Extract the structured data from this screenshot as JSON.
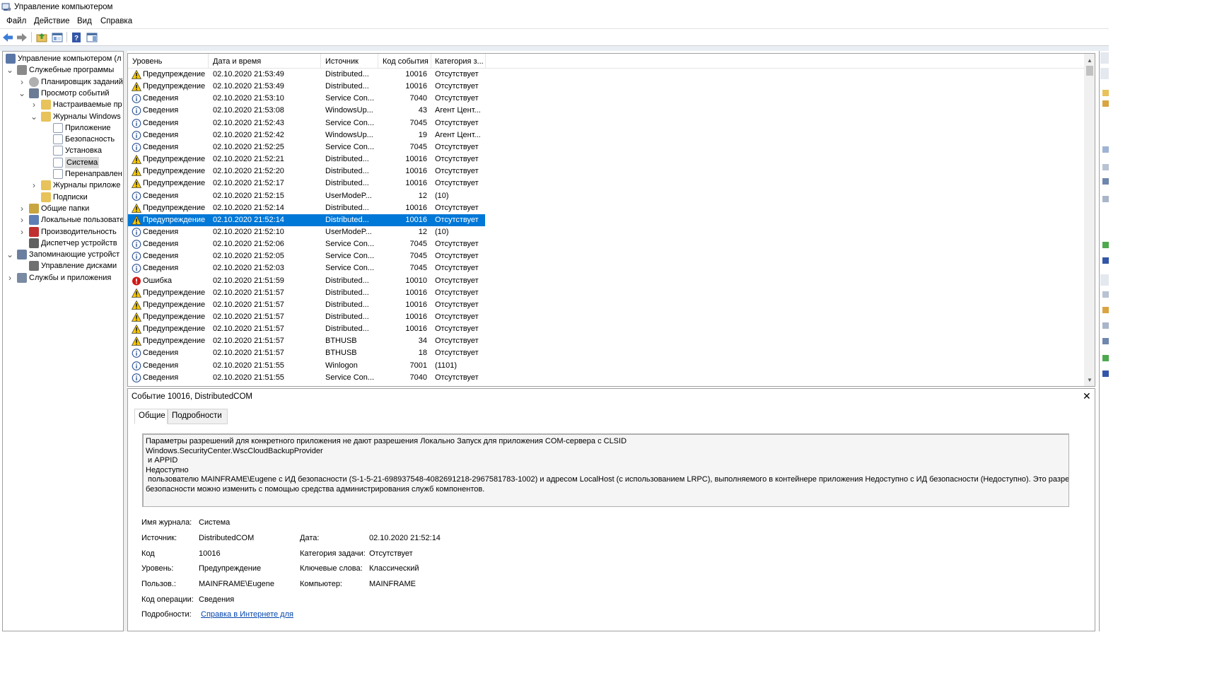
{
  "window": {
    "title": "Управление компьютером"
  },
  "menu": [
    "Файл",
    "Действие",
    "Вид",
    "Справка"
  ],
  "tree": [
    {
      "label": "Управление компьютером (л",
      "icon": "computer-management-icon",
      "expander": ""
    },
    {
      "label": "Служебные программы",
      "icon": "tools-icon",
      "expander": "expanded"
    },
    {
      "label": "Планировщик заданий",
      "icon": "clock-icon",
      "expander": "collapsed"
    },
    {
      "label": "Просмотр событий",
      "icon": "event-viewer-icon",
      "expander": "expanded"
    },
    {
      "label": "Настраиваемые пр",
      "icon": "folder-icon",
      "expander": "collapsed"
    },
    {
      "label": "Журналы Windows",
      "icon": "folder-icon",
      "expander": "expanded"
    },
    {
      "label": "Приложение",
      "icon": "log-icon",
      "expander": ""
    },
    {
      "label": "Безопасность",
      "icon": "log-icon",
      "expander": ""
    },
    {
      "label": "Установка",
      "icon": "log-icon",
      "expander": ""
    },
    {
      "label": "Система",
      "icon": "log-icon",
      "expander": "",
      "selected": true
    },
    {
      "label": "Перенаправлен",
      "icon": "log-icon",
      "expander": ""
    },
    {
      "label": "Журналы приложе",
      "icon": "folder-icon",
      "expander": "collapsed"
    },
    {
      "label": "Подписки",
      "icon": "subscriptions-icon",
      "expander": ""
    },
    {
      "label": "Общие папки",
      "icon": "shared-folders-icon",
      "expander": "collapsed"
    },
    {
      "label": "Локальные пользовате",
      "icon": "users-icon",
      "expander": "collapsed"
    },
    {
      "label": "Производительность",
      "icon": "performance-icon",
      "expander": "collapsed"
    },
    {
      "label": "Диспетчер устройств",
      "icon": "device-manager-icon",
      "expander": ""
    },
    {
      "label": "Запоминающие устройст",
      "icon": "storage-icon",
      "expander": "expanded"
    },
    {
      "label": "Управление дисками",
      "icon": "disk-icon",
      "expander": ""
    },
    {
      "label": "Службы и приложения",
      "icon": "services-icon",
      "expander": "collapsed"
    }
  ],
  "columns": [
    "Уровень",
    "Дата и время",
    "Источник",
    "Код события",
    "Категория з..."
  ],
  "events": [
    {
      "level": "Предупреждение",
      "type": "warning",
      "date": "02.10.2020 21:53:49",
      "source": "Distributed...",
      "code": "10016",
      "category": "Отсутствует"
    },
    {
      "level": "Предупреждение",
      "type": "warning",
      "date": "02.10.2020 21:53:49",
      "source": "Distributed...",
      "code": "10016",
      "category": "Отсутствует"
    },
    {
      "level": "Сведения",
      "type": "info",
      "date": "02.10.2020 21:53:10",
      "source": "Service Con...",
      "code": "7040",
      "category": "Отсутствует"
    },
    {
      "level": "Сведения",
      "type": "info",
      "date": "02.10.2020 21:53:08",
      "source": "WindowsUp...",
      "code": "43",
      "category": "Агент Цент..."
    },
    {
      "level": "Сведения",
      "type": "info",
      "date": "02.10.2020 21:52:43",
      "source": "Service Con...",
      "code": "7045",
      "category": "Отсутствует"
    },
    {
      "level": "Сведения",
      "type": "info",
      "date": "02.10.2020 21:52:42",
      "source": "WindowsUp...",
      "code": "19",
      "category": "Агент Цент..."
    },
    {
      "level": "Сведения",
      "type": "info",
      "date": "02.10.2020 21:52:25",
      "source": "Service Con...",
      "code": "7045",
      "category": "Отсутствует"
    },
    {
      "level": "Предупреждение",
      "type": "warning",
      "date": "02.10.2020 21:52:21",
      "source": "Distributed...",
      "code": "10016",
      "category": "Отсутствует"
    },
    {
      "level": "Предупреждение",
      "type": "warning",
      "date": "02.10.2020 21:52:20",
      "source": "Distributed...",
      "code": "10016",
      "category": "Отсутствует"
    },
    {
      "level": "Предупреждение",
      "type": "warning",
      "date": "02.10.2020 21:52:17",
      "source": "Distributed...",
      "code": "10016",
      "category": "Отсутствует"
    },
    {
      "level": "Сведения",
      "type": "info",
      "date": "02.10.2020 21:52:15",
      "source": "UserModeP...",
      "code": "12",
      "category": "(10)"
    },
    {
      "level": "Предупреждение",
      "type": "warning",
      "date": "02.10.2020 21:52:14",
      "source": "Distributed...",
      "code": "10016",
      "category": "Отсутствует"
    },
    {
      "level": "Предупреждение",
      "type": "warning",
      "date": "02.10.2020 21:52:14",
      "source": "Distributed...",
      "code": "10016",
      "category": "Отсутствует",
      "selected": true
    },
    {
      "level": "Сведения",
      "type": "info",
      "date": "02.10.2020 21:52:10",
      "source": "UserModeP...",
      "code": "12",
      "category": "(10)"
    },
    {
      "level": "Сведения",
      "type": "info",
      "date": "02.10.2020 21:52:06",
      "source": "Service Con...",
      "code": "7045",
      "category": "Отсутствует"
    },
    {
      "level": "Сведения",
      "type": "info",
      "date": "02.10.2020 21:52:05",
      "source": "Service Con...",
      "code": "7045",
      "category": "Отсутствует"
    },
    {
      "level": "Сведения",
      "type": "info",
      "date": "02.10.2020 21:52:03",
      "source": "Service Con...",
      "code": "7045",
      "category": "Отсутствует"
    },
    {
      "level": "Ошибка",
      "type": "error",
      "date": "02.10.2020 21:51:59",
      "source": "Distributed...",
      "code": "10010",
      "category": "Отсутствует"
    },
    {
      "level": "Предупреждение",
      "type": "warning",
      "date": "02.10.2020 21:51:57",
      "source": "Distributed...",
      "code": "10016",
      "category": "Отсутствует"
    },
    {
      "level": "Предупреждение",
      "type": "warning",
      "date": "02.10.2020 21:51:57",
      "source": "Distributed...",
      "code": "10016",
      "category": "Отсутствует"
    },
    {
      "level": "Предупреждение",
      "type": "warning",
      "date": "02.10.2020 21:51:57",
      "source": "Distributed...",
      "code": "10016",
      "category": "Отсутствует"
    },
    {
      "level": "Предупреждение",
      "type": "warning",
      "date": "02.10.2020 21:51:57",
      "source": "Distributed...",
      "code": "10016",
      "category": "Отсутствует"
    },
    {
      "level": "Предупреждение",
      "type": "warning",
      "date": "02.10.2020 21:51:57",
      "source": "BTHUSB",
      "code": "34",
      "category": "Отсутствует"
    },
    {
      "level": "Сведения",
      "type": "info",
      "date": "02.10.2020 21:51:57",
      "source": "BTHUSB",
      "code": "18",
      "category": "Отсутствует"
    },
    {
      "level": "Сведения",
      "type": "info",
      "date": "02.10.2020 21:51:55",
      "source": "Winlogon",
      "code": "7001",
      "category": "(1101)"
    },
    {
      "level": "Сведения",
      "type": "info",
      "date": "02.10.2020 21:51:55",
      "source": "Service Con...",
      "code": "7040",
      "category": "Отсутствует"
    }
  ],
  "detail": {
    "title": "Событие 10016, DistributedCOM",
    "tabs": [
      "Общие",
      "Подробности"
    ],
    "message_lines": [
      "Параметры разрешений для конкретного приложения не дают разрешения Локально Запуск для приложения COM-сервера с CLSID",
      "Windows.SecurityCenter.WscCloudBackupProvider",
      " и APPID",
      "Недоступно",
      " пользователю MAINFRAME\\Eugene с ИД безопасности (S-1-5-21-698937548-4082691218-2967581783-1002) и адресом LocalHost (с использованием LRPC), выполняемого в контейнере приложения Недоступно с ИД безопасности (Недоступно). Это разрешение",
      "безопасности можно изменить с помощью средства администрирования служб компонентов."
    ],
    "fields": {
      "log_label": "Имя журнала:",
      "log_value": "Система",
      "source_label": "Источник:",
      "source_value": "DistributedCOM",
      "date_label": "Дата:",
      "date_value": "02.10.2020 21:52:14",
      "code_label": "Код",
      "code_value": "10016",
      "task_label": "Категория задачи:",
      "task_value": "Отсутствует",
      "level_label": "Уровень:",
      "level_value": "Предупреждение",
      "keywords_label": "Ключевые слова:",
      "keywords_value": "Классический",
      "user_label": "Пользов.:",
      "user_value": "MAINFRAME\\Eugene",
      "computer_label": "Компьютер:",
      "computer_value": "MAINFRAME",
      "opcode_label": "Код операции:",
      "opcode_value": "Сведения",
      "details_label": "Подробности:",
      "details_link": "Справка в Интернете для"
    }
  },
  "colors": {
    "selection": "#0078d7",
    "tree_selection": "#d9d9d9",
    "warning": "#f6c700",
    "error": "#d01818",
    "info": "#2f5597",
    "link": "#0645ad"
  },
  "toolbar": [
    "back-icon",
    "forward-icon",
    "up-folder-icon",
    "show-tree-icon",
    "help-icon",
    "action-pane-icon"
  ]
}
